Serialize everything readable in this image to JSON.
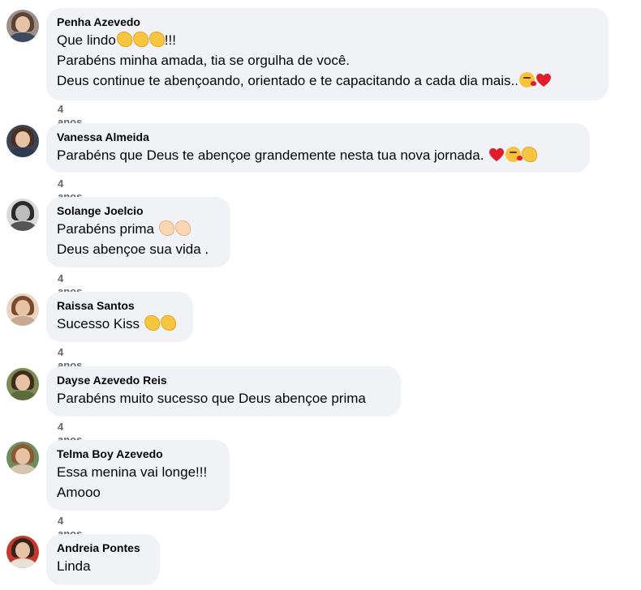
{
  "comments": [
    {
      "author": "Penha Azevedo",
      "lines": [
        "Que lindo",
        "Parabéns minha amada, tia se orgulha de você.",
        "Deus continue te abençoando, orientado e te capacitando a cada dia mais.."
      ],
      "line1_suffix": "!!!",
      "time": "4 anos"
    },
    {
      "author": "Vanessa Almeida",
      "lines": [
        "Parabéns que Deus te abençoe grandemente nesta tua nova jornada."
      ],
      "time": "4 anos"
    },
    {
      "author": "Solange Joelcio",
      "lines": [
        "Parabéns prima",
        "Deus abençoe sua vida ."
      ],
      "time": "4 anos"
    },
    {
      "author": "Raissa Santos",
      "lines": [
        "Sucesso Kiss"
      ],
      "time": "4 anos"
    },
    {
      "author": "Dayse Azevedo Reis",
      "lines": [
        "Parabéns muito sucesso que Deus abençoe prima"
      ],
      "time": "4 anos"
    },
    {
      "author": "Telma Boy Azevedo",
      "lines": [
        "Essa menina vai longe!!!",
        "Amooo"
      ],
      "time": "4 anos"
    },
    {
      "author": "Andreia Pontes",
      "lines": [
        "Linda"
      ]
    }
  ],
  "emoji_names": [
    "clapping-hands-emoji",
    "face-blowing-kiss-emoji",
    "red-heart-emoji"
  ],
  "colors": {
    "bubble": "#f0f2f5",
    "name": "#050505",
    "time": "#65676b"
  }
}
